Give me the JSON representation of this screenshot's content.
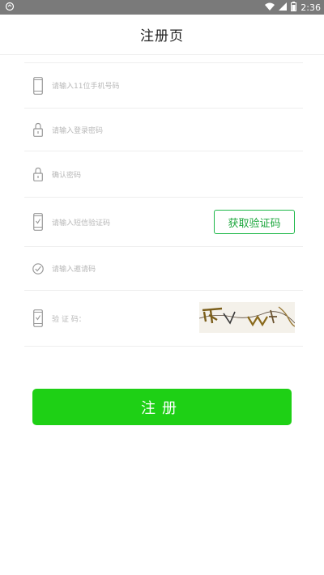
{
  "status_bar": {
    "time": "2:36",
    "icons": [
      "sync-icon",
      "wifi-icon",
      "signal-icon",
      "battery-icon"
    ]
  },
  "header": {
    "title": "注册页"
  },
  "form": {
    "phone_placeholder": "请输入11位手机号码",
    "password_placeholder": "请输入登录密码",
    "confirm_placeholder": "确认密码",
    "sms_placeholder": "请输入短信验证码",
    "get_code_label": "获取验证码",
    "invite_placeholder": "请输入邀请码",
    "captcha_label": "验 证 码："
  },
  "actions": {
    "register_label": "注册"
  },
  "colors": {
    "accent": "#1ed015",
    "button_border": "#1fb84a",
    "statusbar": "#7a7a7a"
  }
}
